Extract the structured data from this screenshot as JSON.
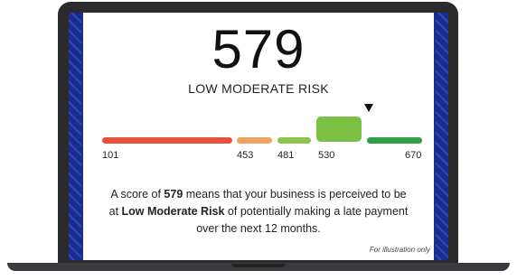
{
  "score": "579",
  "risk_label": "LOW MODERATE RISK",
  "scale": {
    "segments": [
      {
        "color": "#e8503a",
        "active": false
      },
      {
        "color": "#f0a35c",
        "active": false
      },
      {
        "color": "#8dc34a",
        "active": false
      },
      {
        "color": "#7cc043",
        "active": true
      },
      {
        "color": "#2e9e47",
        "active": false
      }
    ],
    "ticks": [
      "101",
      "453",
      "481",
      "530",
      "670"
    ]
  },
  "description": {
    "prefix": "A score of ",
    "score": "579",
    "middle": " means that your business is perceived to be at ",
    "risk": "Low Moderate Risk",
    "suffix": " of potentially making a late payment over the next 12 months."
  },
  "footnote": "For illustration only"
}
